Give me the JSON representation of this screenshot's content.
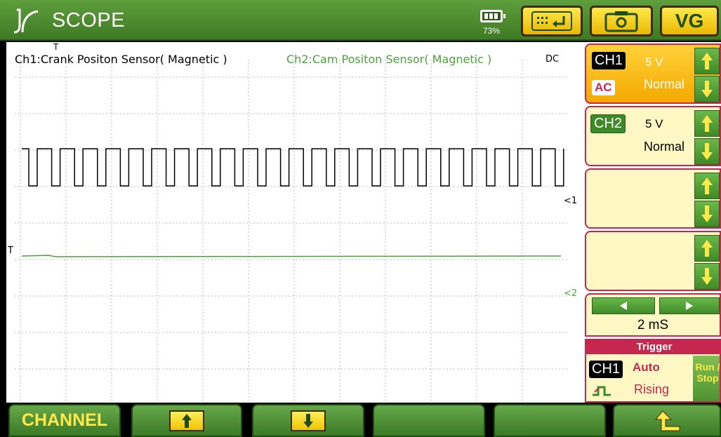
{
  "header": {
    "title": "SCOPE",
    "battery_percent": "73%",
    "battery_level": 0.73,
    "icons": [
      "logo-icon",
      "battery-icon",
      "keyboard-enter-icon",
      "camera-icon"
    ],
    "vg_label": "VG"
  },
  "scope": {
    "ch1_label": "Ch1:Crank Positon Sensor( Magnetic )",
    "ch2_label": "Ch2:Cam Positon Sensor( Magnetic )",
    "coupling": "DC",
    "trigger_marker": "T",
    "ch1_marker": "<1",
    "ch2_marker": "<2",
    "colors": {
      "ch1": "#000000",
      "ch2": "#4aa33a",
      "grid": "#b8b8b8"
    }
  },
  "panel": {
    "ch1": {
      "badge": "CH1",
      "volts": "5 V",
      "mode": "Normal",
      "coupling": "AC"
    },
    "ch2": {
      "badge": "CH2",
      "volts": "5 V",
      "mode": "Normal"
    },
    "timebase": "2 mS",
    "trigger": {
      "title": "Trigger",
      "source": "CH1",
      "mode": "Auto",
      "edge": "Rising",
      "run_stop": "Run / Stop"
    }
  },
  "bottom": {
    "channel_label": "CHANNEL"
  }
}
